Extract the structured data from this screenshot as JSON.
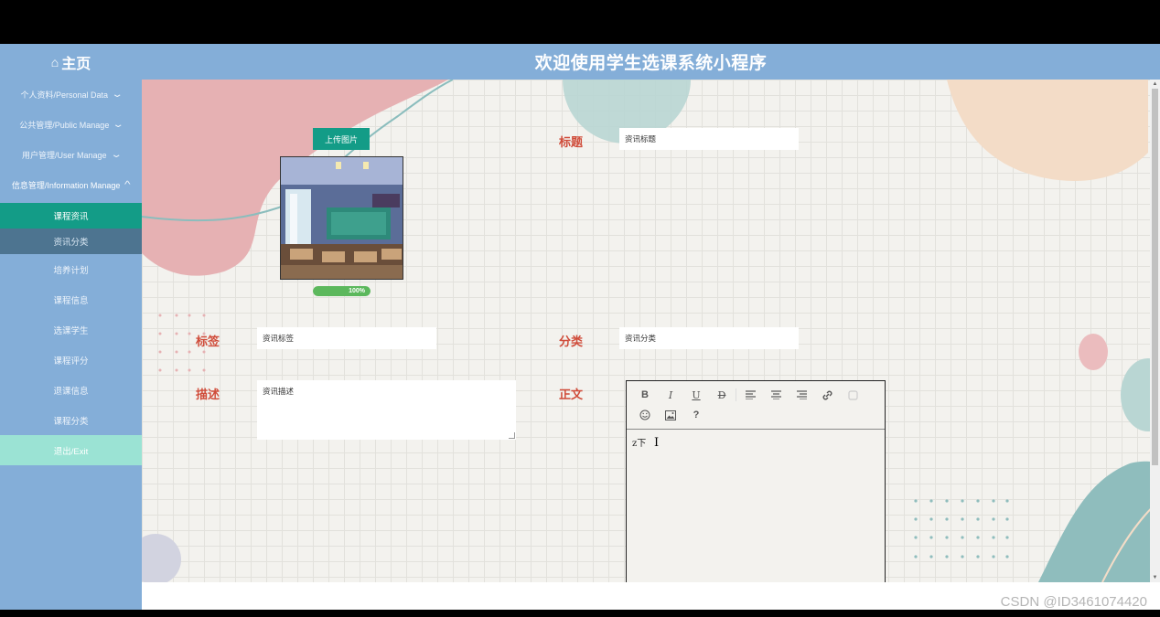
{
  "header": {
    "home_label": "主页",
    "home_icon": "home-icon",
    "title": "欢迎使用学生选课系统小程序"
  },
  "sidebar": {
    "groups": [
      {
        "label": "个人资料/Personal Data"
      },
      {
        "label": "公共管理/Public Manage"
      },
      {
        "label": "用户管理/User Manage"
      },
      {
        "label": "信息管理/Information Manage"
      }
    ],
    "items": [
      {
        "label": "课程资讯"
      },
      {
        "label": "资讯分类"
      },
      {
        "label": "培养计划"
      },
      {
        "label": "课程信息"
      },
      {
        "label": "选课学生"
      },
      {
        "label": "课程评分"
      },
      {
        "label": "退课信息"
      },
      {
        "label": "课程分类"
      },
      {
        "label": "退出/Exit"
      }
    ]
  },
  "form": {
    "upload_label": "上传图片",
    "progress_text": "100%",
    "progress_value": 1.0,
    "title_label": "标题",
    "title_value": "资讯标题",
    "tag_label": "标签",
    "tag_value": "资讯标签",
    "category_label": "分类",
    "category_value": "资讯分类",
    "desc_label": "描述",
    "desc_value": "资讯描述",
    "body_label": "正文",
    "body_value": "z下"
  },
  "editor_toolbar": {
    "bold": "B",
    "italic": "I",
    "underline": "U",
    "strike": "D",
    "help": "?"
  },
  "watermark": "CSDN @ID3461074420",
  "colors": {
    "header_bg": "#84aed8",
    "active_item": "#139c87",
    "label_red": "#d04c3a",
    "exit_bg": "#9be3d4"
  }
}
